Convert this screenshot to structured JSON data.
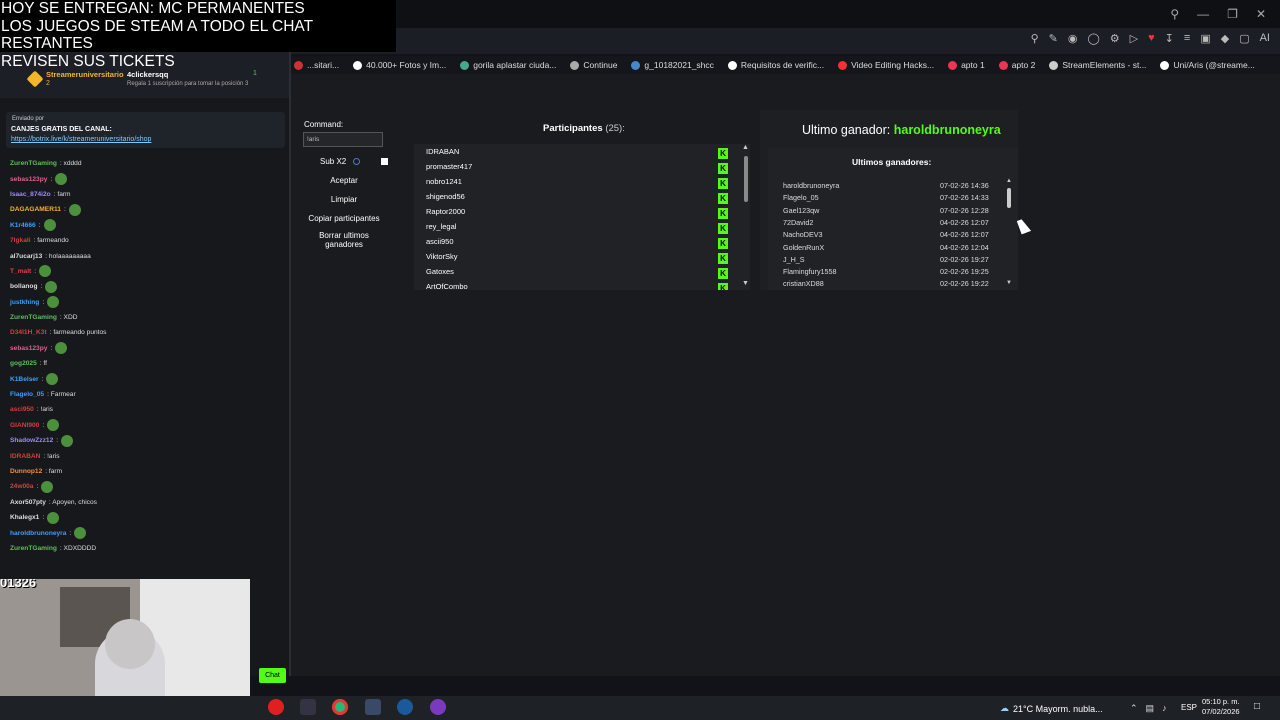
{
  "overlay": {
    "line1": "HOY SE ENTREGAN: MC PERMANENTES",
    "line2": "LOS JUEGOS DE STEAM A TODO EL CHAT RESTANTES",
    "line3": "REVISEN SUS TICKETS"
  },
  "bookmarks": [
    {
      "label": "...sitari...",
      "color": "#c33"
    },
    {
      "label": "40.000+ Fotos y Im...",
      "color": "#fff"
    },
    {
      "label": "gorila aplastar ciuda...",
      "color": "#4a8"
    },
    {
      "label": "Continue",
      "color": "#aaa"
    },
    {
      "label": "g_10182021_shcc",
      "color": "#48c"
    },
    {
      "label": "Requisitos de verific...",
      "color": "#fff"
    },
    {
      "label": "Video Editing Hacks...",
      "color": "#e33"
    },
    {
      "label": "apto 1",
      "color": "#e35"
    },
    {
      "label": "apto 2",
      "color": "#e35"
    },
    {
      "label": "StreamElements - st...",
      "color": "#ccc"
    },
    {
      "label": "Uni/Aris (@streame...",
      "color": "#fff"
    }
  ],
  "chat": {
    "streamer_name": "Streameruniversitario",
    "streamer_sub": "2",
    "gifter_name": "4clickersqq",
    "gifter_note": "Regala 1 suscripción para tomar la posición 3",
    "gifter_count": "1",
    "pinned_sent": "Enviado por",
    "pinned_title": "CANJES GRATIS DEL CANAL:",
    "pinned_link": "https://botrix.live/k/streameruniversitario/shop",
    "messages": [
      {
        "user": "ZurenTGaming",
        "text": ": xdddd",
        "color": "#5fbf5f"
      },
      {
        "user": "sebas123py",
        "text": ":",
        "color": "#e06090"
      },
      {
        "user": "Isaac_874i2o",
        "text": ": farm",
        "color": "#9a8cff"
      },
      {
        "user": "DAGAGAMER11",
        "text": ":",
        "color": "#f3b62a"
      },
      {
        "user": "K1r4666",
        "text": ":",
        "color": "#3aa0ff"
      },
      {
        "user": "7lgkali",
        "text": ": farmeando",
        "color": "#d04040"
      },
      {
        "user": "al7ucarj13",
        "text": ": holaaaaaaaaa",
        "color": "#ddd"
      },
      {
        "user": "T_malt",
        "text": ":",
        "color": "#e04040"
      },
      {
        "user": "bollanog",
        "text": ":",
        "color": "#ddd"
      },
      {
        "user": "justkhing",
        "text": ":",
        "color": "#3aa0ff"
      },
      {
        "user": "ZurenTGaming",
        "text": ": XDD",
        "color": "#5fbf5f"
      },
      {
        "user": "D34I1H_K3t",
        "text": ": farmeando puntos",
        "color": "#d04040"
      },
      {
        "user": "sebas123py",
        "text": ":",
        "color": "#e06090"
      },
      {
        "user": "gog2025",
        "text": ": ff",
        "color": "#5fbf5f"
      },
      {
        "user": "K1Belser",
        "text": ":",
        "color": "#3aa0ff"
      },
      {
        "user": "Flagelo_05",
        "text": ": Farmear",
        "color": "#3aa0ff"
      },
      {
        "user": "asci950",
        "text": ": !aris",
        "color": "#d04040"
      },
      {
        "user": "GIANI900",
        "text": ":",
        "color": "#d04040"
      },
      {
        "user": "ShadowZzz12",
        "text": ":",
        "color": "#9a8cff"
      },
      {
        "user": "IDRABAN",
        "text": ": !aris",
        "color": "#d04040"
      },
      {
        "user": "Dunnop12",
        "text": ": farm",
        "color": "#f09040"
      },
      {
        "user": "24w00a",
        "text": ":",
        "color": "#d04040"
      },
      {
        "user": "Axor507pty",
        "text": ": Apoyen, chicos",
        "color": "#ddd"
      },
      {
        "user": "Khalegx1",
        "text": ":",
        "color": "#ddd"
      },
      {
        "user": "haroldbrunoneyra",
        "text": ":",
        "color": "#3aa0ff"
      },
      {
        "user": "ZurenTGaming",
        "text": ": XDXDDDD",
        "color": "#5fbf5f"
      }
    ],
    "cam_number": "01326",
    "chat_button": "Chat"
  },
  "app": {
    "command_label": "Command:",
    "command_value": "!aris",
    "sub_x2": "Sub X2",
    "buttons": [
      "Aceptar",
      "Limpiar",
      "Copiar participantes",
      "Borrar ultimos ganadores"
    ],
    "participants_label": "Participantes",
    "participants_count": "(25):",
    "participants": [
      "IDRABAN",
      "promaster417",
      "nobro1241",
      "shigenod56",
      "Raptor2000",
      "rey_legal",
      "ascii950",
      "ViktorSky",
      "Gatoxes",
      "ArtOfCombo"
    ],
    "platform_badge": "K",
    "last_winner_label": "Ultimo ganador:",
    "last_winner": "haroldbrunoneyra",
    "last_winners_title": "Ultimos ganadores:",
    "winners": [
      {
        "name": "haroldbrunoneyra",
        "date": "07-02-26 14:36"
      },
      {
        "name": "Flagelo_05",
        "date": "07-02-26 14:33"
      },
      {
        "name": "Gael123qw",
        "date": "07-02-26 12:28"
      },
      {
        "name": "72David2",
        "date": "04-02-26 12:07"
      },
      {
        "name": "NachoDEV3",
        "date": "04-02-26 12:07"
      },
      {
        "name": "GoldenRunX",
        "date": "04-02-26 12:04"
      },
      {
        "name": "J_H_S",
        "date": "02-02-26 19:27"
      },
      {
        "name": "Flamingfury1558",
        "date": "02-02-26 19:25"
      },
      {
        "name": "cristianXD88",
        "date": "02-02-26 19:22"
      }
    ]
  },
  "taskbar": {
    "weather": "21°C  Mayorm. nubla...",
    "lang": "ESP",
    "time": "05:10 p. m.",
    "date": "07/02/2026"
  }
}
